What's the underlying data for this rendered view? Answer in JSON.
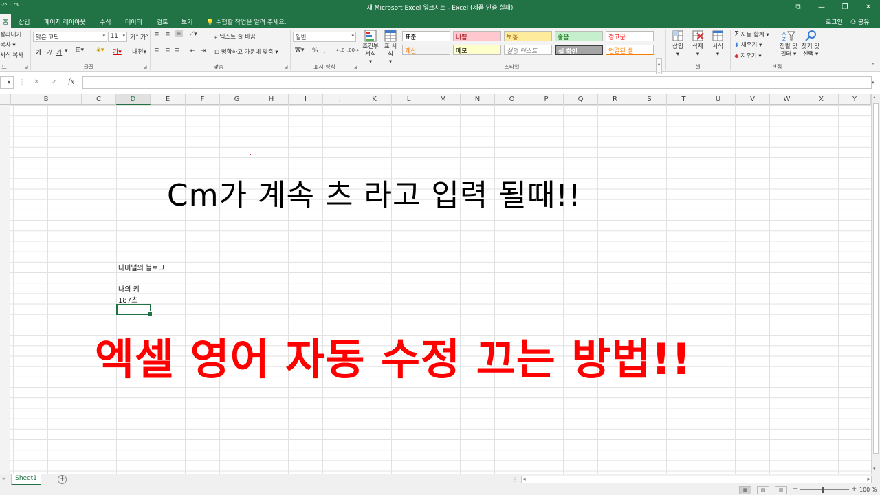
{
  "window": {
    "title": "새 Microsoft Excel 워크시트 - Excel (제품 인증 실패)",
    "qat": "↶ · ↷ ·",
    "controls": [
      "⧉",
      "—",
      "❐",
      "✕"
    ]
  },
  "tabs": [
    {
      "label": "홈",
      "active": true
    },
    {
      "label": "삽입"
    },
    {
      "label": "페이지 레이아웃"
    },
    {
      "label": "수식"
    },
    {
      "label": "데이터"
    },
    {
      "label": "검토"
    },
    {
      "label": "보기"
    }
  ],
  "tell_me": "수행할 작업을 알려 주세요.",
  "account": {
    "login": "로그인",
    "share": "공유"
  },
  "ribbon": {
    "clipboard": {
      "cut": "잘라내기",
      "copy": "복사",
      "format_painter": "서식 복사",
      "label": "드"
    },
    "font": {
      "name": "맑은 고딕",
      "size": "11",
      "label": "글꼴",
      "bold": "가",
      "italic": "가",
      "underline": "가",
      "grow": "가",
      "shrink": "가",
      "phonetic": "내천"
    },
    "alignment": {
      "wrap_text": "텍스트 줄 바꿈",
      "merge_center": "병합하고 가운데 맞춤",
      "label": "맞춤"
    },
    "number": {
      "format": "일반",
      "percent": "%",
      "comma": ",",
      "label": "표시 형식"
    },
    "styles": {
      "conditional": "조건부 서식",
      "table": "표 서식",
      "label": "스타일",
      "cells": [
        {
          "text": "표준",
          "bg": "#ffffff",
          "fg": "#000000"
        },
        {
          "text": "나쁨",
          "bg": "#ffc7ce",
          "fg": "#9c0006"
        },
        {
          "text": "보통",
          "bg": "#ffeb9c",
          "fg": "#9c5700"
        },
        {
          "text": "좋음",
          "bg": "#c6efce",
          "fg": "#006100"
        },
        {
          "text": "경고문",
          "bg": "#ffffff",
          "fg": "#ff0000"
        },
        {
          "text": "계산",
          "bg": "#f2f2f2",
          "fg": "#fa7d00"
        },
        {
          "text": "메모",
          "bg": "#ffffcc",
          "fg": "#000000"
        },
        {
          "text": "설명 텍스트",
          "bg": "#ffffff",
          "fg": "#7f7f7f"
        },
        {
          "text": "셀 확인",
          "bg": "#a5a5a5",
          "fg": "#ffffff"
        },
        {
          "text": "연결된 셀",
          "bg": "#ffffff",
          "fg": "#fa7d00"
        }
      ]
    },
    "cells": {
      "insert": "삽입",
      "delete": "삭제",
      "format": "서식",
      "label": "셀"
    },
    "editing": {
      "autosum": "자동 합계",
      "fill": "채우기",
      "clear": "지우기",
      "sort_filter": "정렬 및 필터",
      "find_select": "찾기 및 선택",
      "label": "편집"
    }
  },
  "formula_bar": {
    "namebox": "▾",
    "fx": "fx",
    "cancel": "✕",
    "enter": "✓",
    "value": ""
  },
  "columns": [
    "B",
    "C",
    "D",
    "E",
    "F",
    "G",
    "H",
    "I",
    "J",
    "K",
    "L",
    "M",
    "N",
    "O",
    "P",
    "Q",
    "R",
    "S",
    "T",
    "U",
    "V",
    "W",
    "X",
    "Y"
  ],
  "selected_column": "D",
  "cells": {
    "d16": "나미널의  블로그",
    "d18": "나의 키",
    "d19": "187츠"
  },
  "overlays": {
    "line1": "Cm가   계속 츠  라고 입력 될때!!",
    "line2": "엑셀 영어 자동 수정 끄는 방법!!"
  },
  "sheets": [
    {
      "name": "Sheet1",
      "active": true
    }
  ],
  "add_sheet": "+",
  "status": {
    "zoom": "100 %"
  },
  "colors": {
    "excel_green": "#217346",
    "headline_red": "#ff0000"
  }
}
